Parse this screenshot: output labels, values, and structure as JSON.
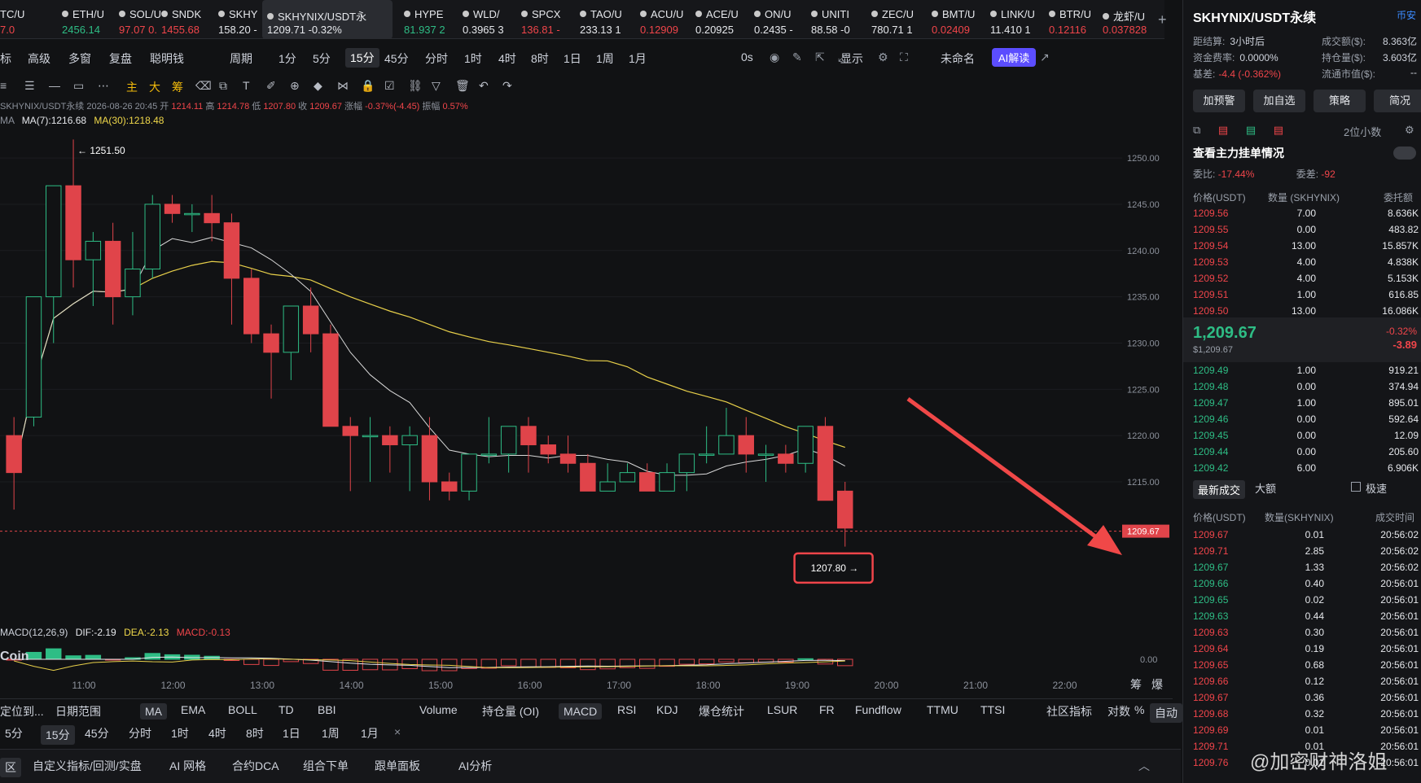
{
  "ticker": [
    {
      "name": "TC/U",
      "price": "7.0",
      "dir": "dn",
      "left": 0,
      "w": 40
    },
    {
      "name": "ETH/U",
      "price": "2456.14",
      "dir": "up",
      "left": 62,
      "w": 68
    },
    {
      "name": "SOL/U",
      "price": "97.07 0.",
      "dir": "dn",
      "left": 132,
      "w": 68
    },
    {
      "name": "SNDK",
      "price": "1455.68",
      "dir": "dn",
      "left": 184,
      "w": 58
    },
    {
      "name": "SKHY",
      "price": "158.20 -",
      "dir": "wt",
      "left": 254,
      "w": 62
    },
    {
      "name": "SKHYNIX/USDT永",
      "price": "1209.71 -0.32%",
      "dir": "wt",
      "left": 322,
      "w": 148,
      "active": true
    },
    {
      "name": "HYPE",
      "price": "81.937 2",
      "dir": "up",
      "left": 482,
      "w": 58
    },
    {
      "name": "WLD/",
      "price": "0.3965 3",
      "dir": "wt",
      "left": 554,
      "w": 60
    },
    {
      "name": "SPCX",
      "price": "136.81 -",
      "dir": "dn",
      "left": 626,
      "w": 60
    },
    {
      "name": "TAO/U",
      "price": "233.13 1",
      "dir": "wt",
      "left": 698,
      "w": 62
    },
    {
      "name": "ACU/U",
      "price": "0.12909",
      "dir": "dn",
      "left": 772,
      "w": 60
    },
    {
      "name": "ACE/U",
      "price": "0.20925",
      "dir": "wt",
      "left": 840,
      "w": 62
    },
    {
      "name": "ON/U",
      "price": "0.2435 -",
      "dir": "wt",
      "left": 912,
      "w": 62
    },
    {
      "name": "UNITI",
      "price": "88.58 -0",
      "dir": "wt",
      "left": 982,
      "w": 62
    },
    {
      "name": "ZEC/U",
      "price": "780.71 1",
      "dir": "wt",
      "left": 1056,
      "w": 62
    },
    {
      "name": "BMT/U",
      "price": "0.02409",
      "dir": "dn",
      "left": 1130,
      "w": 60
    },
    {
      "name": "LINK/U",
      "price": "11.410 1",
      "dir": "wt",
      "left": 1202,
      "w": 62
    },
    {
      "name": "BTR/U",
      "price": "0.12116",
      "dir": "dn",
      "left": 1274,
      "w": 58
    },
    {
      "name": "龙虾/U",
      "price": "0.037828",
      "dir": "dn",
      "left": 1340,
      "w": 62
    }
  ],
  "toolbar1": [
    "标",
    "高级",
    "多窗",
    "复盘",
    "聪明钱",
    "周期",
    "1分",
    "5分",
    "15分",
    "45分",
    "分时",
    "1时",
    "4时",
    "8时",
    "1日",
    "1周",
    "1月",
    "0s",
    "显示",
    "未命名",
    "AI解读"
  ],
  "toolbar2": [
    "主",
    "大",
    "筹"
  ],
  "info": {
    "symbol": "SKHYNIX/USDT永续",
    "time": "2026-08-26 20:45",
    "open_label": "开",
    "open": "1214.11",
    "high_label": "高",
    "high": "1214.78",
    "low_label": "低",
    "low": "1207.80",
    "close_label": "收",
    "close": "1209.67",
    "chg_label": "涨幅",
    "chg": "-0.37%(-4.45)",
    "amp_label": "振幅",
    "amp": "0.57%"
  },
  "ma": {
    "label": "MA",
    "ma7": "MA(7):1216.68",
    "ma30": "MA(30):1218.48"
  },
  "macd": {
    "label": "MACD(12,26,9)",
    "dif": "DIF:-2.19",
    "dea": "DEA:-2.13",
    "macd": "MACD:-0.13"
  },
  "watermark_logo": "Coin",
  "chart_data": {
    "type": "candlestick",
    "interval": "15分",
    "x_ticks": [
      "11:00",
      "12:00",
      "13:00",
      "14:00",
      "15:00",
      "16:00",
      "17:00",
      "18:00",
      "19:00",
      "20:00",
      "21:00",
      "22:00"
    ],
    "y_ticks": [
      "1250.00",
      "1245.00",
      "1240.00",
      "1235.00",
      "1230.00",
      "1225.00",
      "1220.00",
      "1215.00"
    ],
    "ylim": [
      1205.5,
      1253
    ],
    "last_price": "1209.67",
    "high_marker": "1251.50",
    "low_marker": "1207.80",
    "macd_zero": "0.00",
    "candles": [
      [
        1220,
        1222,
        1212,
        1216
      ],
      [
        1222,
        1235,
        1221,
        1235
      ],
      [
        1235,
        1247,
        1230,
        1247
      ],
      [
        1247,
        1252,
        1236,
        1239
      ],
      [
        1239,
        1242,
        1234,
        1241
      ],
      [
        1241,
        1243,
        1232,
        1235
      ],
      [
        1235,
        1242,
        1233,
        1238
      ],
      [
        1238,
        1246,
        1237,
        1245
      ],
      [
        1245,
        1246,
        1243,
        1244
      ],
      [
        1244,
        1245,
        1242,
        1244
      ],
      [
        1244,
        1246,
        1241,
        1243
      ],
      [
        1243,
        1244,
        1232,
        1237
      ],
      [
        1237,
        1238,
        1230,
        1231
      ],
      [
        1231,
        1232,
        1224,
        1229
      ],
      [
        1229,
        1234,
        1226,
        1234
      ],
      [
        1234,
        1236,
        1229,
        1231
      ],
      [
        1231,
        1232,
        1221,
        1221
      ],
      [
        1221,
        1222,
        1214,
        1220
      ],
      [
        1220,
        1222,
        1215,
        1220
      ],
      [
        1220,
        1221,
        1216,
        1219
      ],
      [
        1219,
        1221,
        1214,
        1220
      ],
      [
        1220,
        1222,
        1213,
        1215
      ],
      [
        1215,
        1216,
        1213,
        1214
      ],
      [
        1214,
        1218,
        1213,
        1218
      ],
      [
        1218,
        1222,
        1217,
        1218
      ],
      [
        1218,
        1221,
        1216,
        1221
      ],
      [
        1221,
        1222,
        1216,
        1219
      ],
      [
        1219,
        1220,
        1217,
        1218
      ],
      [
        1218,
        1220,
        1216,
        1217
      ],
      [
        1217,
        1218,
        1214,
        1214
      ],
      [
        1214,
        1217,
        1214,
        1215
      ],
      [
        1215,
        1217,
        1215,
        1216
      ],
      [
        1216,
        1217,
        1214,
        1214
      ],
      [
        1214,
        1217,
        1214,
        1216
      ],
      [
        1216,
        1218,
        1214,
        1218
      ],
      [
        1218,
        1221,
        1217,
        1218
      ],
      [
        1218,
        1223,
        1218,
        1220
      ],
      [
        1220,
        1222,
        1216,
        1218
      ],
      [
        1218,
        1219,
        1215,
        1218
      ],
      [
        1218,
        1219,
        1216,
        1217
      ],
      [
        1217,
        1221,
        1216,
        1221
      ],
      [
        1221,
        1222,
        1213,
        1213
      ],
      [
        1214,
        1215,
        1208,
        1210
      ]
    ]
  },
  "side": {
    "title": "SKHYNIX/USDT永续",
    "exchange": "币安",
    "rows": [
      {
        "k": "距结算:",
        "v": "3小时后",
        "k2": "成交额($):",
        "v2": "8.363亿"
      },
      {
        "k": "资金费率:",
        "v": "0.0000%",
        "k2": "持仓量($):",
        "v2": "3.603亿"
      },
      {
        "k": "基差:",
        "v": "-4.4 (-0.362%)",
        "k2": "流通市值($):",
        "v2": "--"
      }
    ],
    "buttons": [
      "加预警",
      "加自选",
      "策略",
      "简况"
    ],
    "precision": "2位小数",
    "depth_title": "查看主力挂单情况",
    "ratio_label": "委比:",
    "ratio": "-17.44%",
    "diff_label": "委差:",
    "diff": "-92",
    "ob_headers": [
      "价格(USDT)",
      "数量 (SKHYNIX)",
      "委托额"
    ],
    "asks": [
      [
        "1209.56",
        "7.00",
        "8.636K"
      ],
      [
        "1209.55",
        "0.00",
        "483.82"
      ],
      [
        "1209.54",
        "13.00",
        "15.857K"
      ],
      [
        "1209.53",
        "4.00",
        "4.838K"
      ],
      [
        "1209.52",
        "4.00",
        "5.153K"
      ],
      [
        "1209.51",
        "1.00",
        "616.85"
      ],
      [
        "1209.50",
        "13.00",
        "16.086K"
      ]
    ],
    "mid": {
      "price": "1,209.67",
      "usd": "$1,209.67",
      "pct": "-0.32%",
      "chg": "-3.89"
    },
    "bids": [
      [
        "1209.49",
        "1.00",
        "919.21"
      ],
      [
        "1209.48",
        "0.00",
        "374.94"
      ],
      [
        "1209.47",
        "1.00",
        "895.01"
      ],
      [
        "1209.46",
        "0.00",
        "592.64"
      ],
      [
        "1209.45",
        "0.00",
        "12.09"
      ],
      [
        "1209.44",
        "0.00",
        "205.60"
      ],
      [
        "1209.42",
        "6.00",
        "6.906K"
      ]
    ],
    "trade_tabs": [
      "最新成交",
      "大额"
    ],
    "fast": "极速",
    "trade_headers": [
      "价格(USDT)",
      "数量(SKHYNIX)",
      "成交时间"
    ],
    "trades": [
      [
        "1209.67",
        "0.01",
        "20:56:02",
        "dn"
      ],
      [
        "1209.71",
        "2.85",
        "20:56:02",
        "dn"
      ],
      [
        "1209.67",
        "1.33",
        "20:56:02",
        "up"
      ],
      [
        "1209.66",
        "0.40",
        "20:56:01",
        "up"
      ],
      [
        "1209.65",
        "0.02",
        "20:56:01",
        "up"
      ],
      [
        "1209.63",
        "0.44",
        "20:56:01",
        "up"
      ],
      [
        "1209.63",
        "0.30",
        "20:56:01",
        "dn"
      ],
      [
        "1209.64",
        "0.19",
        "20:56:01",
        "dn"
      ],
      [
        "1209.65",
        "0.68",
        "20:56:01",
        "dn"
      ],
      [
        "1209.66",
        "0.12",
        "20:56:01",
        "dn"
      ],
      [
        "1209.67",
        "0.36",
        "20:56:01",
        "dn"
      ],
      [
        "1209.68",
        "0.32",
        "20:56:01",
        "dn"
      ],
      [
        "1209.69",
        "0.01",
        "20:56:01",
        "dn"
      ],
      [
        "1209.71",
        "0.01",
        "20:56:01",
        "dn"
      ],
      [
        "1209.76",
        "0.01",
        "20:56:01",
        "dn"
      ]
    ]
  },
  "bottom1": [
    "定位到...",
    "日期范围",
    "MA",
    "EMA",
    "BOLL",
    "TD",
    "BBI",
    "Volume",
    "持仓量 (OI)",
    "MACD",
    "RSI",
    "KDJ",
    "爆仓统计",
    "LSUR",
    "FR",
    "Fundflow",
    "TTMU",
    "TTSI",
    "社区指标",
    "对数",
    "%",
    "自动"
  ],
  "bottom2": [
    "5分",
    "15分",
    "45分",
    "分时",
    "1时",
    "4时",
    "8时",
    "1日",
    "1周",
    "1月"
  ],
  "bottom3": [
    "区",
    "自定义指标/回测/实盘",
    "AI 网格",
    "合约DCA",
    "组合下单",
    "跟单面板",
    "AI分析"
  ],
  "right_axis_extra": [
    "筹",
    "爆"
  ],
  "watermark": "@加密财神洛姐"
}
